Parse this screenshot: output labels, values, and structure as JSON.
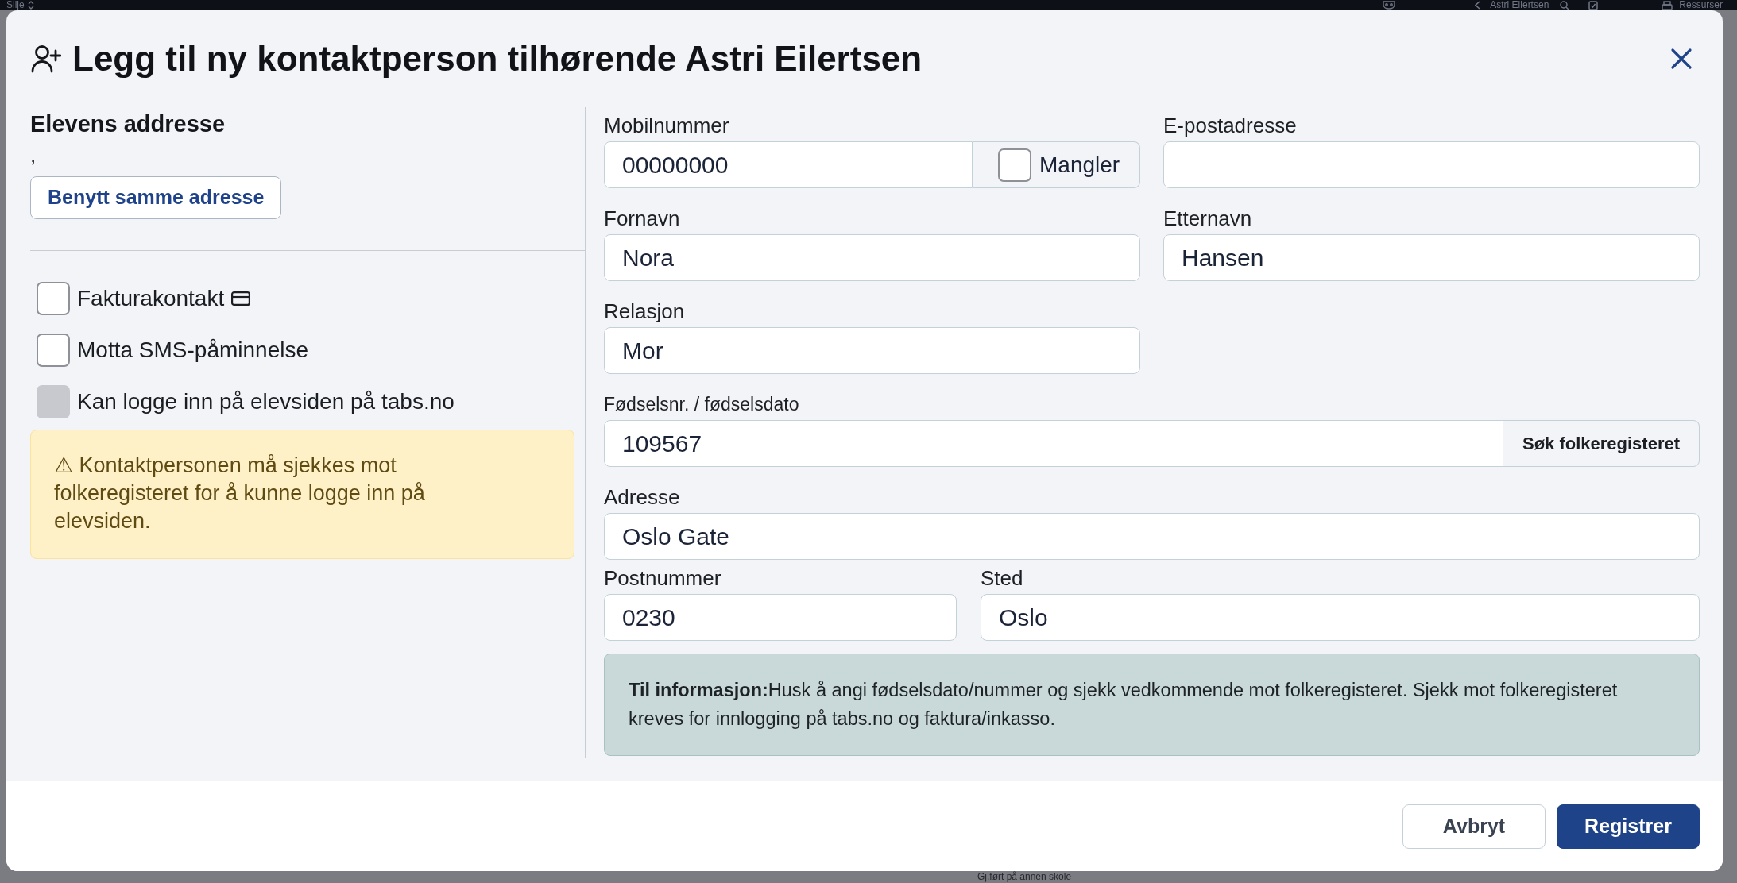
{
  "background_page": {
    "top_bar": {
      "user_name": "Silje",
      "student_name": "Astri Eilertsen",
      "resources_link": "Ressurser"
    },
    "visible_row_text": "Gj.ført på annen skole"
  },
  "dialog": {
    "title": "Legg til ny kontaktperson tilhørende Astri Eilertsen"
  },
  "student_address": {
    "heading": "Elevens addresse",
    "address": ",",
    "button": "Benytt samme adresse"
  },
  "options": [
    {
      "kind": "invoice",
      "label": "Fakturakontakt",
      "checked": false,
      "disabled": false
    },
    {
      "kind": "plain",
      "label": "Motta SMS-påminnelse",
      "checked": false,
      "disabled": false
    },
    {
      "kind": "plain",
      "label": "Kan logge inn på elevsiden på tabs.no",
      "checked": false,
      "disabled": true
    }
  ],
  "login_warning": "⚠ Kontaktpersonen må sjekkes mot folkeregisteret for å kunne logge inn på elevsiden.",
  "form": {
    "rows": [
      {
        "kind": "pair",
        "fields": [
          {
            "kind": "phone",
            "label": "Mobilnummer",
            "value": "00000000",
            "addon": {
              "label": "Mangler",
              "checked": false
            }
          },
          {
            "kind": "text",
            "label": "E-postadresse"
          }
        ]
      },
      {
        "kind": "pair",
        "fields": [
          {
            "kind": "text",
            "label": "Fornavn",
            "value": "Nora"
          },
          {
            "kind": "text",
            "label": "Etternavn",
            "value": "Hansen"
          }
        ]
      },
      {
        "kind": "half",
        "fields": [
          {
            "kind": "text",
            "label": "Relasjon",
            "value": "Mor"
          }
        ]
      },
      {
        "kind": "full",
        "fields": [
          {
            "kind": "lookup",
            "label": "Fødselsnr. / fødselsdato",
            "value": "109567",
            "button": "Søk folkeregisteret"
          }
        ]
      },
      {
        "kind": "full",
        "fields": [
          {
            "kind": "text",
            "label": "Adresse",
            "value": "Oslo Gate"
          }
        ]
      },
      {
        "kind": "postal",
        "fields": [
          {
            "kind": "text",
            "label": "Postnummer",
            "value": "0230"
          },
          {
            "kind": "text",
            "label": "Sted",
            "value": "Oslo"
          }
        ]
      }
    ]
  },
  "info": "**Til informasjon:**Husk å angi fødselsdato/nummer og sjekk vedkommende mot folkeregisteret. Sjekk mot folkeregisteret kreves for innlogging på tabs.no og faktura/inkasso.",
  "footer": {
    "buttons": [
      {
        "kind": "secondary",
        "label": "Avbryt"
      },
      {
        "kind": "primary",
        "label": "Registrer"
      }
    ]
  }
}
